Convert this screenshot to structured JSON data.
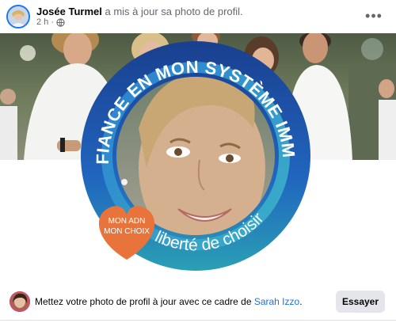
{
  "post": {
    "author_name": "Josée Turmel",
    "action_text": "a mis à jour sa photo de profil.",
    "time_text": "2 h ·",
    "more_icon": "more-horizontal-icon",
    "privacy_icon": "globe-icon"
  },
  "frame": {
    "ring_top_text": "J'AI CONFIANCE EN MON SYSTÈME IMMUNITAIRE",
    "ring_bottom_text": "liberté de choisir",
    "heart_line1": "MON ADN",
    "heart_line2": "MON CHOIX",
    "colors": {
      "ring_outer": "#1f5fb8",
      "ring_inner": "#2b8fd4",
      "ring_bottom": "#2a9db0",
      "heart": "#e8743b"
    }
  },
  "footer": {
    "prompt_text": "Mettez votre photo de profil à jour avec ce cadre de ",
    "creator_name": "Sarah Izzo",
    "period": ".",
    "try_label": "Essayer"
  }
}
